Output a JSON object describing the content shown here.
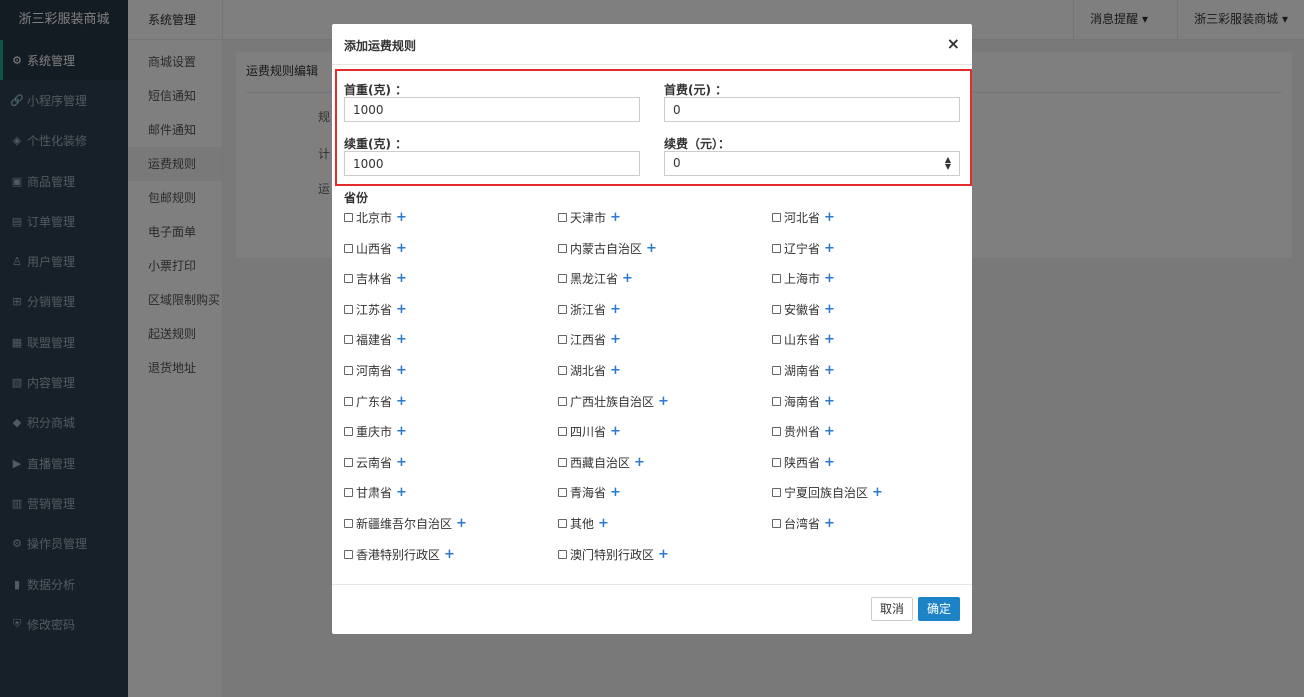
{
  "sidebar": {
    "brand": "浙三彩服装商城",
    "items": [
      {
        "label": "系统管理",
        "icon": "gear-icon",
        "glyph": "⚙"
      },
      {
        "label": "小程序管理",
        "icon": "link-icon",
        "glyph": "🔗"
      },
      {
        "label": "个性化装修",
        "icon": "diamond-icon",
        "glyph": "◈"
      },
      {
        "label": "商品管理",
        "icon": "bag-icon",
        "glyph": "▣"
      },
      {
        "label": "订单管理",
        "icon": "clipboard-icon",
        "glyph": "▤"
      },
      {
        "label": "用户管理",
        "icon": "user-icon",
        "glyph": "♙"
      },
      {
        "label": "分销管理",
        "icon": "sitemap-icon",
        "glyph": "⊞"
      },
      {
        "label": "联盟管理",
        "icon": "store-icon",
        "glyph": "▦"
      },
      {
        "label": "内容管理",
        "icon": "newspaper-icon",
        "glyph": "▧"
      },
      {
        "label": "积分商城",
        "icon": "cube-icon",
        "glyph": "◆"
      },
      {
        "label": "直播管理",
        "icon": "play-icon",
        "glyph": "▶"
      },
      {
        "label": "营销管理",
        "icon": "gift-icon",
        "glyph": "▥"
      },
      {
        "label": "操作员管理",
        "icon": "cog-icon",
        "glyph": "⚙"
      },
      {
        "label": "数据分析",
        "icon": "bar-chart-icon",
        "glyph": "▮"
      },
      {
        "label": "修改密码",
        "icon": "shield-icon",
        "glyph": "⛨"
      }
    ]
  },
  "subnav": {
    "title": "系统管理",
    "items": [
      "商城设置",
      "短信通知",
      "邮件通知",
      "运费规则",
      "包邮规则",
      "电子面单",
      "小票打印",
      "区域限制购买",
      "起送规则",
      "退货地址"
    ]
  },
  "topbar": {
    "messages": "消息提醒",
    "shop": "浙三彩服装商城",
    "caret": "▾"
  },
  "panel": {
    "title": "运费规则编辑",
    "rows": [
      "规",
      "计",
      "运"
    ]
  },
  "modal": {
    "title": "添加运费规则",
    "close": "×",
    "first_weight_label": "首重(克) ：",
    "first_weight_value": "1000",
    "first_fee_label": "首费(元) ：",
    "first_fee_value": "0",
    "next_weight_label": "续重(克) ：",
    "next_weight_value": "1000",
    "next_fee_label": "续费（元）：",
    "next_fee_value": "0",
    "spin_up": "▲",
    "spin_down": "▼",
    "province_title": "省份",
    "plus": "+",
    "provinces": [
      "北京市",
      "天津市",
      "河北省",
      "山西省",
      "内蒙古自治区",
      "辽宁省",
      "吉林省",
      "黑龙江省",
      "上海市",
      "江苏省",
      "浙江省",
      "安徽省",
      "福建省",
      "江西省",
      "山东省",
      "河南省",
      "湖北省",
      "湖南省",
      "广东省",
      "广西壮族自治区",
      "海南省",
      "重庆市",
      "四川省",
      "贵州省",
      "云南省",
      "西藏自治区",
      "陕西省",
      "甘肃省",
      "青海省",
      "宁夏回族自治区",
      "新疆维吾尔自治区",
      "其他",
      "台湾省",
      "香港特别行政区",
      "澳门特别行政区"
    ],
    "cancel": "取消",
    "confirm": "确定"
  }
}
